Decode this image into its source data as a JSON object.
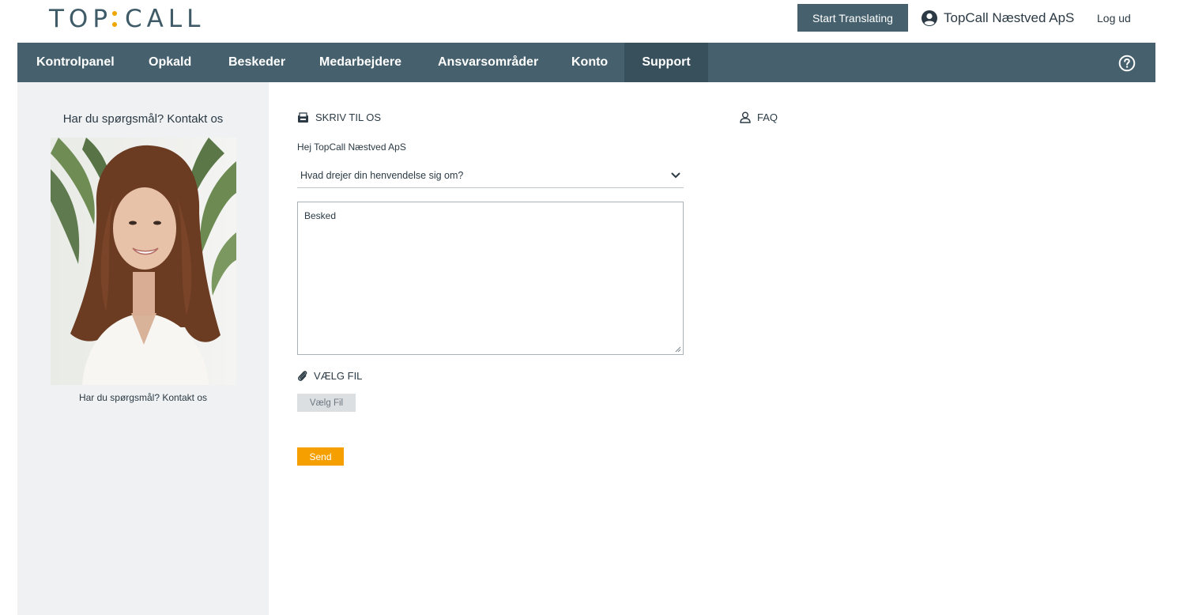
{
  "header": {
    "logo_text_left": "TOP",
    "logo_text_right": "CALL",
    "translate_button": "Start Translating",
    "account_name": "TopCall Næstved ApS",
    "logout": "Log ud"
  },
  "nav": {
    "items": [
      {
        "label": "Kontrolpanel"
      },
      {
        "label": "Opkald"
      },
      {
        "label": "Beskeder"
      },
      {
        "label": "Medarbejdere"
      },
      {
        "label": "Ansvarsområder"
      },
      {
        "label": "Konto"
      },
      {
        "label": "Support"
      }
    ],
    "active": "Support"
  },
  "sidebar": {
    "title": "Har du spørgsmål? Kontakt os",
    "caption": "Har du spørgsmål? Kontakt os"
  },
  "contact_form": {
    "heading": "SKRIV TIL OS",
    "greeting": "Hej TopCall Næstved ApS",
    "topic_select": "Hvad drejer din henvendelse sig om?",
    "message_placeholder": "Besked",
    "file_heading": "VÆLG FIL",
    "file_button": "Vælg Fil",
    "send_button": "Send"
  },
  "faq": {
    "heading": "FAQ"
  },
  "colors": {
    "nav_bg": "#46616d",
    "nav_active": "#37505c",
    "accent": "#f5a000",
    "sidebar_bg": "#f0f1f3"
  }
}
